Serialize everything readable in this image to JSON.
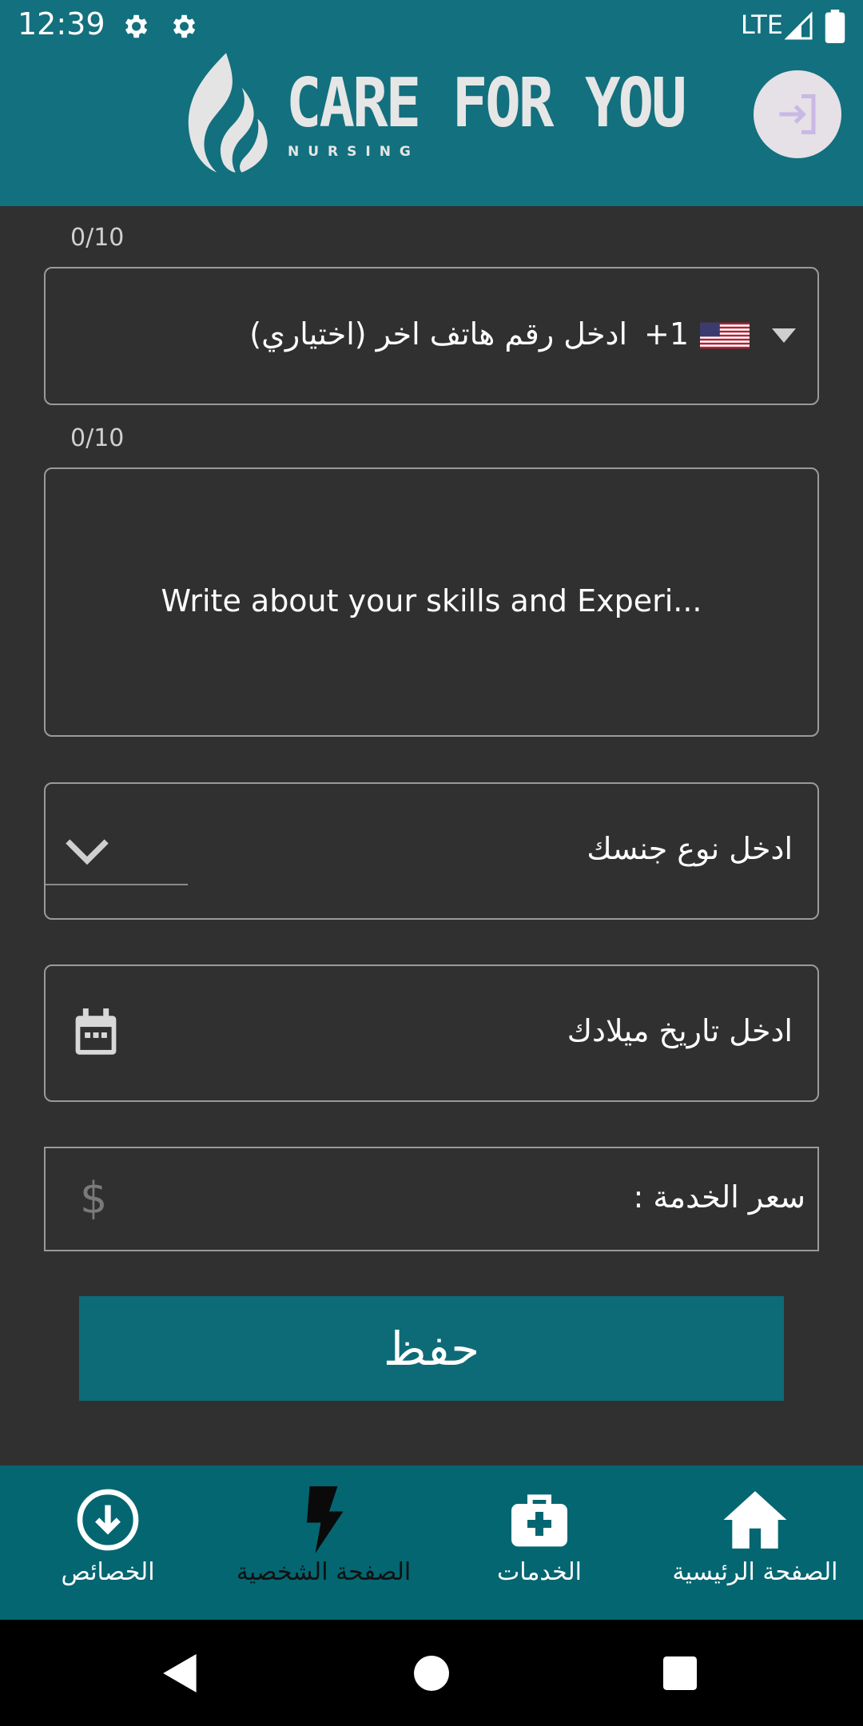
{
  "status_bar": {
    "time": "12:39",
    "network": "LTE",
    "icons": [
      "settings-gear-icon",
      "settings-gear-icon",
      "signal-icon",
      "battery-icon"
    ]
  },
  "header": {
    "logo_title": "CARE FOR YOU",
    "logo_subtitle": "NURSING",
    "login_icon": "login-icon"
  },
  "form": {
    "phone_counter": "0/10",
    "phone_country_code": "+1",
    "phone_flag": "us-flag-icon",
    "phone_placeholder": "ادخل رقم هاتف اخر (اختياري)",
    "about_counter": "0/10",
    "about_placeholder": "Write about your skills and Experi...",
    "gender_placeholder": "ادخل نوع جنسك",
    "birthdate_placeholder": "ادخل تاريخ ميلادك",
    "price_label": "سعر الخدمة :",
    "price_icon_text": "$",
    "save_label": "حفظ"
  },
  "bottom_nav": {
    "items": [
      {
        "label": "الخصائص",
        "icon": "download-circle-icon"
      },
      {
        "label": "الصفحة الشخصية",
        "icon": "lightning-icon"
      },
      {
        "label": "الخدمات",
        "icon": "medical-kit-icon"
      },
      {
        "label": "الصفحة الرئيسية",
        "icon": "home-icon"
      }
    ]
  },
  "colors": {
    "app_bar": "#13707e",
    "background": "#303030",
    "button": "#0d6b77",
    "bottom_nav": "#046671"
  }
}
